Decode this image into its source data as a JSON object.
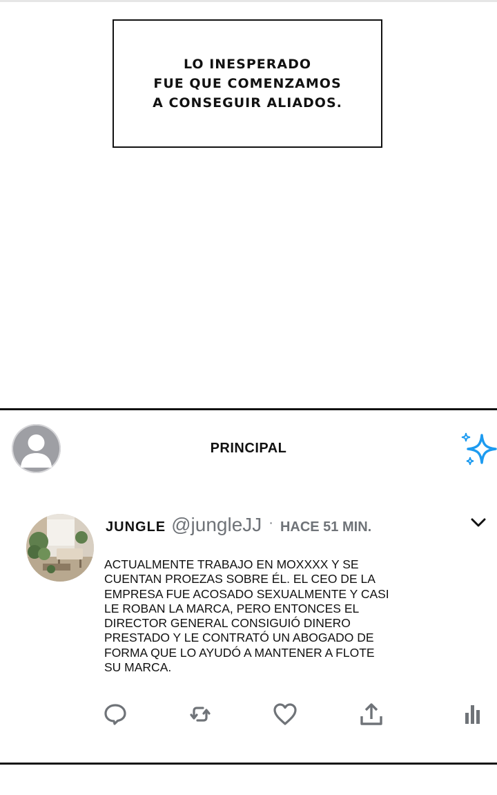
{
  "narration": {
    "lines": [
      "LO INESPERADO",
      "FUE QUE COMENZAMOS",
      "A CONSEGUIR ALIADOS."
    ]
  },
  "panel": {
    "title": "PRINCIPAL"
  },
  "tweet": {
    "author_name": "JUNGLE",
    "handle": "@jungleJJ",
    "separator": "·",
    "time_ago": "HACE 51 MIN.",
    "body_lines": [
      "ACTUALMENTE TRABAJO EN MOXXXX Y SE",
      "CUENTAN PROEZAS SOBRE ÉL. EL CEO DE LA",
      "EMPRESA FUE ACOSADO SEXUALMENTE Y CASI",
      "LE ROBAN LA MARCA, PERO ENTONCES EL",
      "DIRECTOR GENERAL CONSIGUIÓ DINERO",
      "PRESTADO Y LE CONTRATÓ UN ABOGADO DE",
      "FORMA QUE LO AYUDÓ A MANTENER A FLOTE",
      "SU MARCA."
    ]
  },
  "icons": {
    "profile": "default-avatar-icon",
    "sparkle": "sparkle-icon",
    "menu": "chevron-down-icon",
    "reply": "comment-bubble-icon",
    "retweet": "retweet-icon",
    "like": "heart-icon",
    "share": "share-upload-icon",
    "analytics": "bar-chart-icon"
  },
  "colors": {
    "accent_blue": "#1d9bf0",
    "icon_gray": "#6f7378",
    "text": "#111111"
  }
}
